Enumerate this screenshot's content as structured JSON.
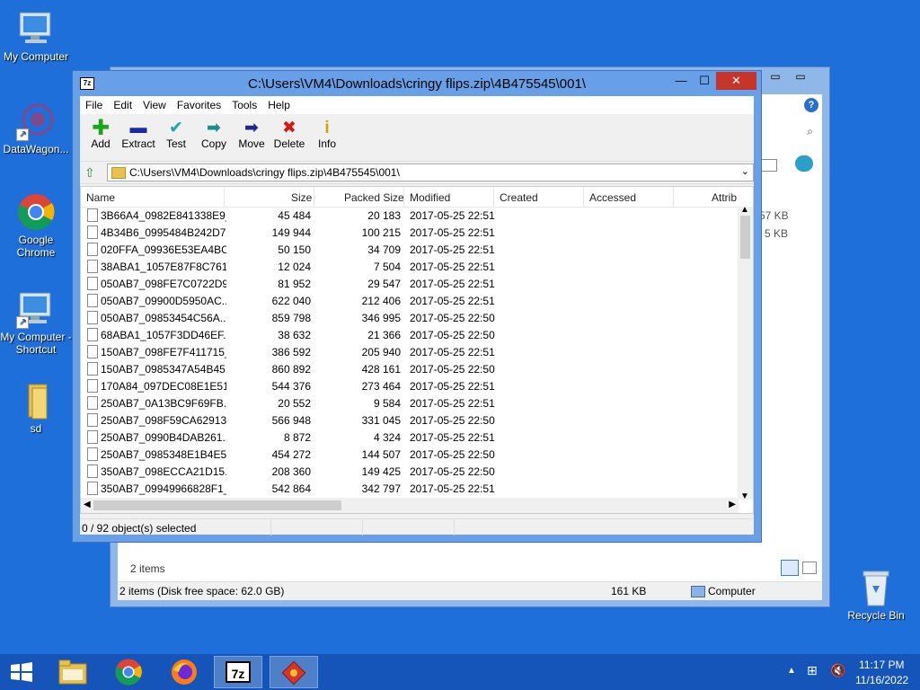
{
  "desktop": {
    "icons": [
      {
        "label": "My Computer"
      },
      {
        "label": "DataWagon..."
      },
      {
        "label": "Google Chrome"
      },
      {
        "label": "My Computer - Shortcut"
      },
      {
        "label": "sd"
      },
      {
        "label": "Recycle Bin"
      }
    ]
  },
  "back_window": {
    "right_sizes": [
      "57 KB",
      "5 KB"
    ],
    "items_count": "2 items",
    "status_left": "2 items (Disk free space: 62.0 GB)",
    "status_size": "161 KB",
    "status_location": "Computer"
  },
  "zip": {
    "title": "C:\\Users\\VM4\\Downloads\\cringy flips.zip\\4B475545\\001\\",
    "menu": [
      "File",
      "Edit",
      "View",
      "Favorites",
      "Tools",
      "Help"
    ],
    "toolbar": [
      "Add",
      "Extract",
      "Test",
      "Copy",
      "Move",
      "Delete",
      "Info"
    ],
    "address": "C:\\Users\\VM4\\Downloads\\cringy flips.zip\\4B475545\\001\\",
    "columns": [
      "Name",
      "Size",
      "Packed Size",
      "Modified",
      "Created",
      "Accessed",
      "Attrib"
    ],
    "rows": [
      {
        "name": "3B66A4_0982E841338E9_...",
        "size": "45 484",
        "packed": "20 183",
        "modified": "2017-05-25 22:51"
      },
      {
        "name": "4B34B6_0995484B242D7...",
        "size": "149 944",
        "packed": "100 215",
        "modified": "2017-05-25 22:51"
      },
      {
        "name": "020FFA_09936E53EA4BC...",
        "size": "50 150",
        "packed": "34 709",
        "modified": "2017-05-25 22:51"
      },
      {
        "name": "38ABA1_1057E87F8C761...",
        "size": "12 024",
        "packed": "7 504",
        "modified": "2017-05-25 22:51"
      },
      {
        "name": "050AB7_098FE7C0722D9...",
        "size": "81 952",
        "packed": "29 547",
        "modified": "2017-05-25 22:51"
      },
      {
        "name": "050AB7_09900D5950AC...",
        "size": "622 040",
        "packed": "212 406",
        "modified": "2017-05-25 22:51"
      },
      {
        "name": "050AB7_09853454C56A...",
        "size": "859 798",
        "packed": "346 995",
        "modified": "2017-05-25 22:50"
      },
      {
        "name": "68ABA1_1057F3DD46EF...",
        "size": "38 632",
        "packed": "21 366",
        "modified": "2017-05-25 22:50"
      },
      {
        "name": "150AB7_098FE7F411715_...",
        "size": "386 592",
        "packed": "205 940",
        "modified": "2017-05-25 22:51"
      },
      {
        "name": "150AB7_0985347A54B45...",
        "size": "860 892",
        "packed": "428 161",
        "modified": "2017-05-25 22:50"
      },
      {
        "name": "170A84_097DEC08E1E51...",
        "size": "544 376",
        "packed": "273 464",
        "modified": "2017-05-25 22:51"
      },
      {
        "name": "250AB7_0A13BC9F69FB...",
        "size": "20 552",
        "packed": "9 584",
        "modified": "2017-05-25 22:51"
      },
      {
        "name": "250AB7_098F59CA62913...",
        "size": "566 948",
        "packed": "331 045",
        "modified": "2017-05-25 22:50"
      },
      {
        "name": "250AB7_0990B4DAB261...",
        "size": "8 872",
        "packed": "4 324",
        "modified": "2017-05-25 22:51"
      },
      {
        "name": "250AB7_0985348E1B4E5...",
        "size": "454 272",
        "packed": "144 507",
        "modified": "2017-05-25 22:50"
      },
      {
        "name": "350AB7_098ECCA21D15...",
        "size": "208 360",
        "packed": "149 425",
        "modified": "2017-05-25 22:50"
      },
      {
        "name": "350AB7_09949966828F1_...",
        "size": "542 864",
        "packed": "342 797",
        "modified": "2017-05-25 22:51"
      }
    ],
    "status": "0 / 92 object(s) selected"
  },
  "taskbar": {
    "time": "11:17 PM",
    "date": "11/16/2022"
  }
}
